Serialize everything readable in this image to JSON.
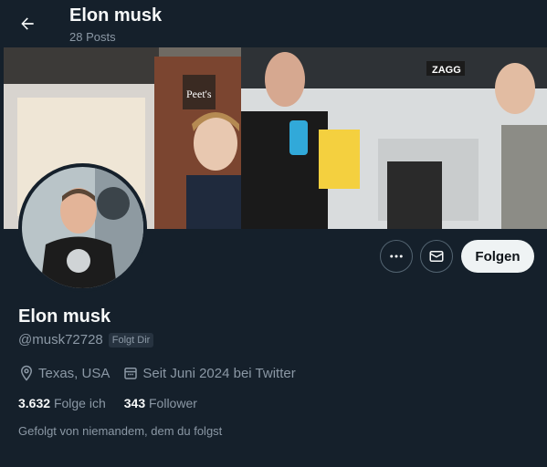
{
  "header": {
    "title": "Elon musk",
    "posts_count": "28 Posts"
  },
  "profile": {
    "name": "Elon musk",
    "handle": "@musk72728",
    "follows_you": "Folgt Dir",
    "location": "Texas, USA",
    "joined": "Seit Juni 2024 bei Twitter",
    "following_count": "3.632",
    "following_label": "Folge ich",
    "followers_count": "343",
    "followers_label": "Follower",
    "followed_by": "Gefolgt von niemandem, dem du folgst"
  },
  "banner": {
    "store_sign": "Peet's",
    "shop_sign": "ZAGG"
  },
  "actions": {
    "follow_label": "Folgen",
    "more_icon": "more-icon",
    "message_icon": "mail-icon"
  },
  "colors": {
    "background": "#15202b",
    "text_primary": "#f7f9f9",
    "text_secondary": "#8b98a5",
    "follow_button": "#eff3f4"
  }
}
